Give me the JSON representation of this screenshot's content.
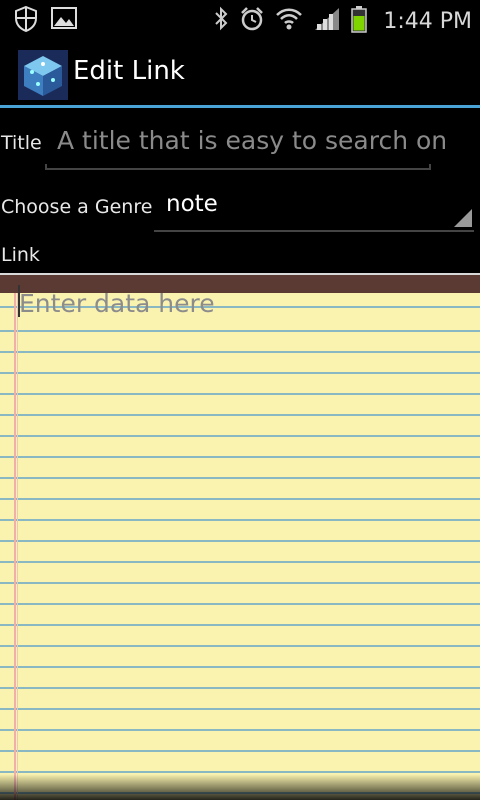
{
  "status_bar": {
    "time": "1:44 PM",
    "left_icons": [
      "shield-icon",
      "image-icon"
    ],
    "right_icons": [
      "bluetooth-icon",
      "alarm-icon",
      "wifi-icon",
      "signal-icon",
      "battery-icon"
    ],
    "battery_color": "#7fd400"
  },
  "title_bar": {
    "title": "Edit Link",
    "divider_color": "#4aa3d6"
  },
  "form": {
    "title_label": "Title",
    "title_placeholder": "A title that is easy to search on",
    "genre_label": "Choose a Genre",
    "genre_value": "note",
    "link_label": "Link"
  },
  "notepad": {
    "placeholder": "Enter data here",
    "paper_color": "#faf3b0",
    "header_color": "#5b3a33"
  }
}
